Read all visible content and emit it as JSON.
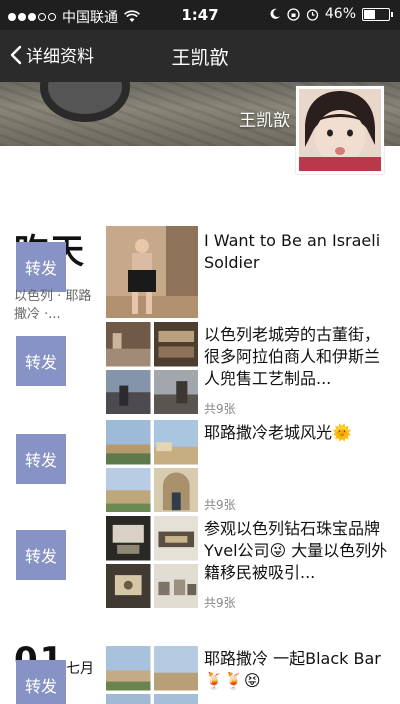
{
  "status_bar": {
    "carrier": "中国联通",
    "time": "1:47",
    "battery": "46%",
    "battery_level": 0.46
  },
  "nav": {
    "back_label": "详细资料",
    "title": "王凯歆"
  },
  "cover": {
    "name": "王凯歆"
  },
  "posts": [
    {
      "date_big": "昨天",
      "left_caption": "以色列 · 耶路撒冷 ·...",
      "share_label": "转发",
      "text": "I Want to Be an Israeli Soldier",
      "count": ""
    },
    {
      "share_label": "转发",
      "text": "以色列老城旁的古董街，很多阿拉伯商人和伊斯兰人兜售工艺制品...",
      "count": "共9张"
    },
    {
      "share_label": "转发",
      "text": "耶路撒冷老城风光🌞",
      "count": "共9张"
    },
    {
      "share_label": "转发",
      "text": "参观以色列钻石珠宝品牌Yvel公司😜 大量以色列外籍移民被吸引...",
      "count": "共9张"
    },
    {
      "date_big": "01",
      "date_small": "七月",
      "share_label": "转发",
      "text": "耶路撒冷 一起Black Bar🍹🍹😝",
      "count": ""
    }
  ]
}
